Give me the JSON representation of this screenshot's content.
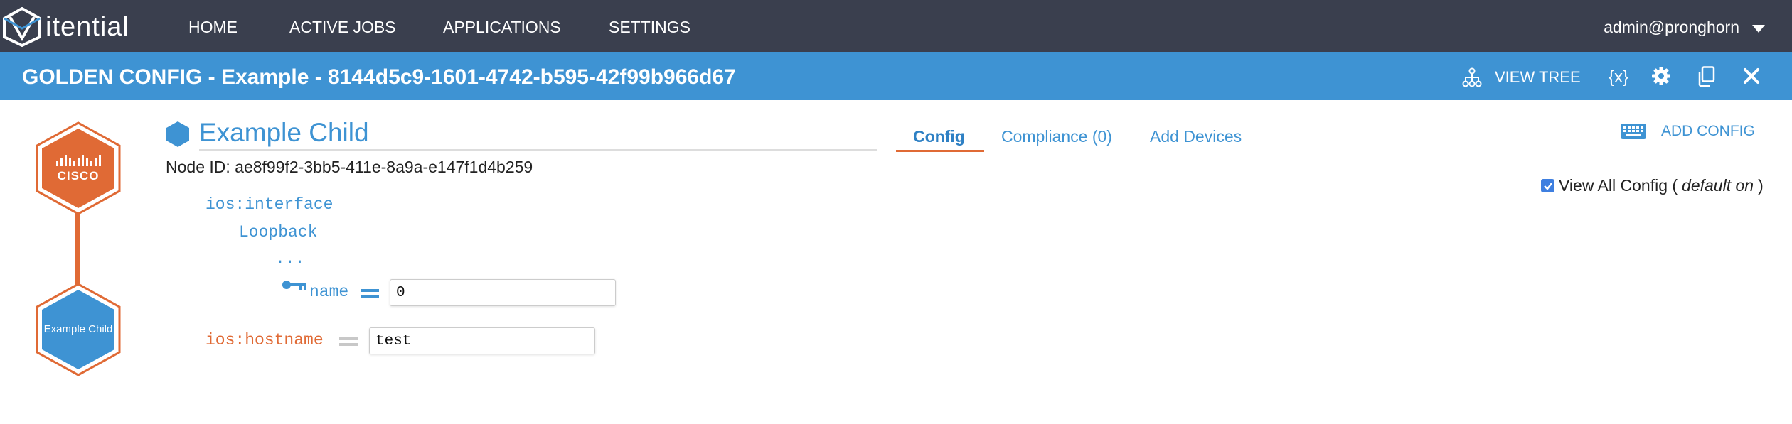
{
  "brand": {
    "name": "itential"
  },
  "nav": {
    "items": [
      {
        "label": "HOME"
      },
      {
        "label": "ACTIVE JOBS"
      },
      {
        "label": "APPLICATIONS"
      },
      {
        "label": "SETTINGS"
      }
    ],
    "user": "admin@pronghorn"
  },
  "titlebar": {
    "title": "GOLDEN CONFIG - Example - 8144d5c9-1601-4742-b595-42f99b966d67",
    "view_tree": "VIEW TREE",
    "variables": "{x}"
  },
  "tree": {
    "root_logo_text": "CISCO",
    "child_label": "Example Child"
  },
  "node": {
    "title": "Example Child",
    "id_text": "Node ID: ae8f99f2-3bb5-411e-8a9a-e147f1d4b259"
  },
  "tabs": [
    {
      "label": "Config",
      "active": true
    },
    {
      "label": "Compliance (0)"
    },
    {
      "label": "Add Devices"
    }
  ],
  "add_config": "ADD CONFIG",
  "view_all": {
    "label": "View All Config (",
    "note": "default on",
    "close": ")",
    "checked": true
  },
  "config": {
    "interface_key": "ios:interface",
    "loopback_key": "Loopback",
    "ellipsis": "...",
    "name_key": "name",
    "name_value": "0",
    "hostname_key": "ios:hostname",
    "hostname_value": "test"
  },
  "colors": {
    "nav_bg": "#3a3f4e",
    "title_bg": "#3e93d3",
    "accent": "#e06a35",
    "link": "#3e93d3"
  },
  "icons": [
    "itential-logo-icon",
    "caret-down-icon",
    "tree-icon",
    "gear-icon",
    "copy-icon",
    "close-icon",
    "cube-icon",
    "keyboard-icon",
    "checkbox-icon",
    "key-icon"
  ]
}
